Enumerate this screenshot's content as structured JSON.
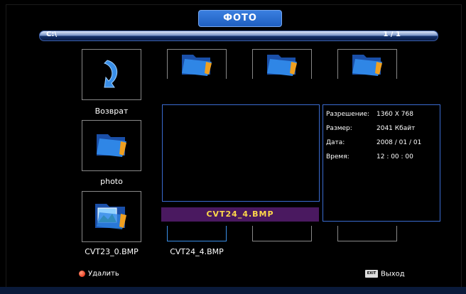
{
  "header": {
    "title": "ФОТО"
  },
  "pathbar": {
    "path": "C:\\",
    "page": "1 / 1"
  },
  "items": [
    {
      "label": "Возврат",
      "icon": "return-arrow-icon"
    },
    {
      "label": "",
      "icon": "folder-icon"
    },
    {
      "label": "",
      "icon": "folder-icon"
    },
    {
      "label": "",
      "icon": "folder-icon"
    },
    {
      "label": "photo",
      "icon": "folder-icon"
    },
    {
      "label": "CVT23_0.BMP",
      "icon": "image-folder-icon"
    },
    {
      "label": "CVT24_4.BMP",
      "icon": "image-folder-icon"
    }
  ],
  "preview": {
    "filename": "CVT24_4.BMP"
  },
  "info": {
    "resolution_label": "Разрешение:",
    "resolution": "1360 X 768",
    "size_label": "Размер:",
    "size": "2041 Кбайт",
    "date_label": "Дата:",
    "date": "2008 / 01 / 01",
    "time_label": "Время:",
    "time": "12 : 00 : 00"
  },
  "footer": {
    "delete_label": "Удалить",
    "exit_key": "EXIT",
    "exit_label": "Выход"
  },
  "colors": {
    "accent": "#1f5fc0",
    "highlight_bar": "#4a1960",
    "filename_text": "#ffd84a",
    "panel_border": "#3a6bd0"
  }
}
